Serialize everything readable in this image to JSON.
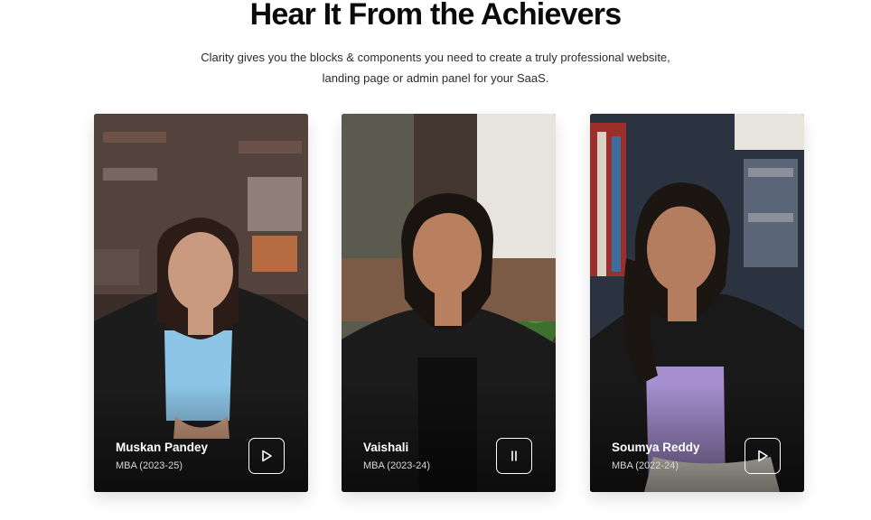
{
  "section": {
    "title": "Hear It From the Achievers",
    "subtitle_line1": "Clarity gives you the blocks & components you need to create a truly professional website,",
    "subtitle_line2": "landing page or admin panel for your SaaS."
  },
  "testimonials": [
    {
      "name": "Muskan Pandey",
      "program": "MBA (2023-25)",
      "control": "play-icon"
    },
    {
      "name": "Vaishali",
      "program": "MBA (2023-24)",
      "control": "pause-icon"
    },
    {
      "name": "Soumya Reddy",
      "program": "MBA (2022-24)",
      "control": "play-icon"
    }
  ],
  "colors": {
    "title": "#0b0b0b",
    "text_on_video": "#ffffff",
    "blazer": "#1c1c1c"
  }
}
